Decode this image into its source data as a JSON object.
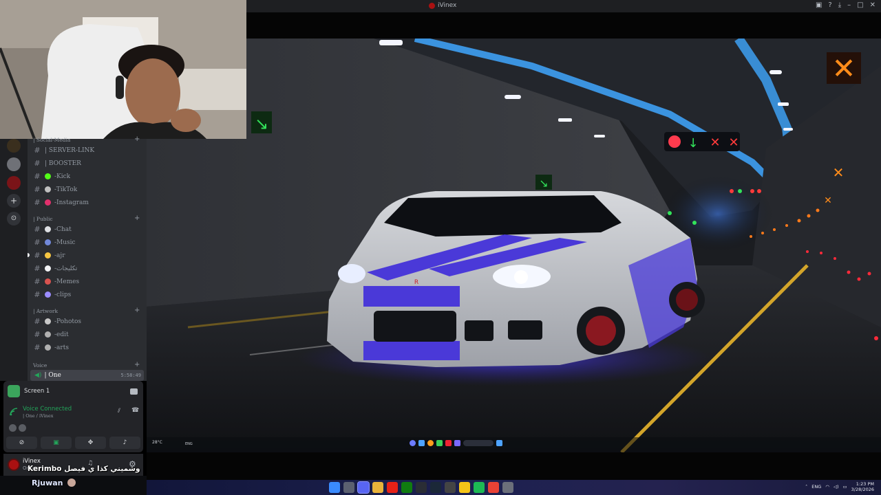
{
  "window": {
    "title": "iVinex"
  },
  "server_names": [
    "server-1",
    "server-2",
    "server-3",
    "add-server",
    "explore"
  ],
  "categories": {
    "social_media": "| Social-Media",
    "public": "| Public",
    "artwork": "| Artwork",
    "voice": "Voice"
  },
  "channels_social": [
    {
      "label": "| SERVER-LINK",
      "emoji_color": ""
    },
    {
      "label": "| BOOSTER",
      "emoji_color": ""
    },
    {
      "label": "-Kick",
      "emoji_color": "#53fc18"
    },
    {
      "label": "-TikTok",
      "emoji_color": "#c0c0c0"
    },
    {
      "label": "-Instagram",
      "emoji_color": "#e1306c"
    }
  ],
  "channels_public": [
    {
      "label": "-Chat",
      "emoji_color": "#dfe1e5"
    },
    {
      "label": "-Music",
      "emoji_color": "#7289da"
    },
    {
      "label": "-ajr",
      "emoji_color": "#f5c542"
    },
    {
      "label": "-تكليجات",
      "emoji_color": "#f2f3f5"
    },
    {
      "label": "-Memes",
      "emoji_color": "#d9534f"
    },
    {
      "label": "-clips",
      "emoji_color": "#9b8cff"
    }
  ],
  "channels_artwork": [
    {
      "label": "-Pohotos",
      "emoji_color": "#c8c8c8"
    },
    {
      "label": "-edit",
      "emoji_color": "#b0b0b0"
    },
    {
      "label": "-arts",
      "emoji_color": "#b0b0b0"
    }
  ],
  "voice_channel": {
    "name": "| One",
    "time": "5:58:49"
  },
  "stream": {
    "label": "Screen 1"
  },
  "voice_status": {
    "label": "Voice Connected",
    "sub": "| One / iVinex"
  },
  "user": {
    "name": "iVinex",
    "status": "Online"
  },
  "overlay": {
    "line1": "Kerimbo  وشميني كذا ي فيصل",
    "line2": "Rjuwan"
  },
  "scene_taskbar": {
    "weather": "28°C",
    "lang": "ENG"
  },
  "taskbar": {
    "lang": "ENG",
    "time": "1:23 PM",
    "date": "3/28/2026"
  },
  "colors": {
    "discord_bg": "#2b2d31",
    "server_bg": "#1e1f22",
    "voice_green": "#23a55a",
    "accent": "#5865f2"
  }
}
